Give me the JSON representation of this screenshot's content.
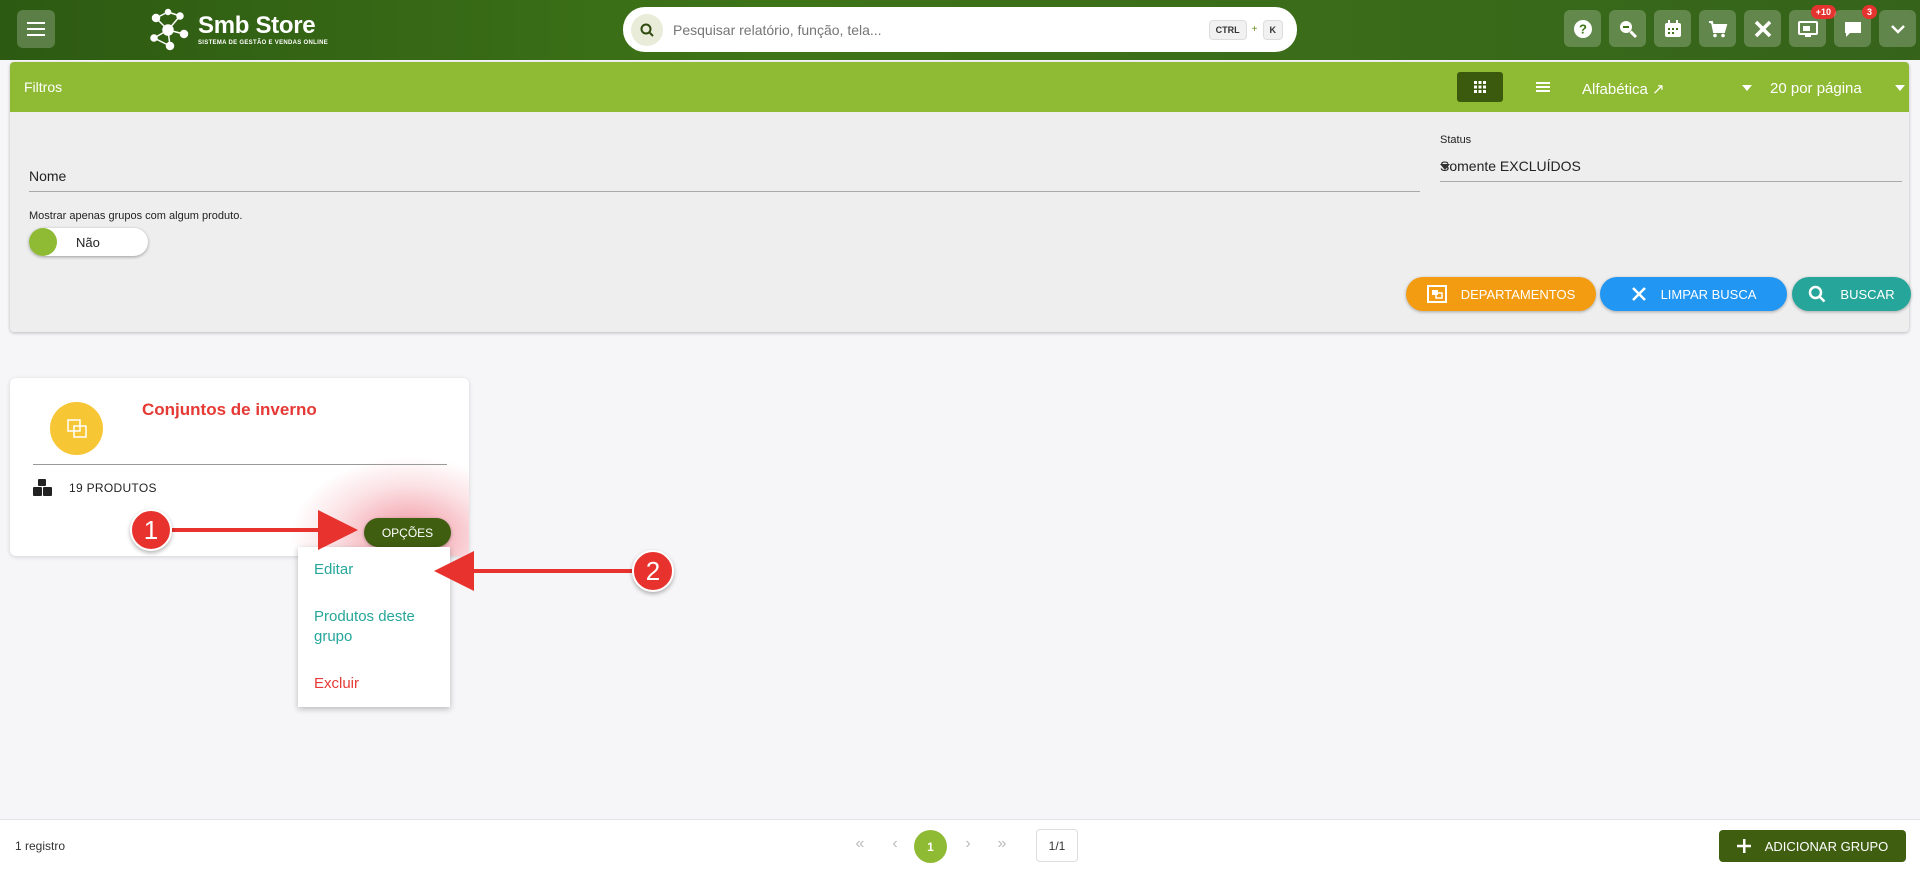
{
  "app": {
    "logo_name": "Smb Store",
    "logo_subtitle": "SISTEMA DE GESTÃO E VENDAS ONLINE"
  },
  "search": {
    "placeholder": "Pesquisar relatório, função, tela...",
    "shortcut_ctrl": "CTRL",
    "shortcut_plus": "+",
    "shortcut_key": "K"
  },
  "top_icons": [
    {
      "icon": "help-icon"
    },
    {
      "icon": "zoom-icon"
    },
    {
      "icon": "calendar-icon"
    },
    {
      "icon": "cart-icon"
    },
    {
      "icon": "tools-icon"
    },
    {
      "icon": "display-icon",
      "badge": "+10"
    },
    {
      "icon": "chat-icon",
      "badge": "3"
    },
    {
      "icon": "chevron-down-icon"
    }
  ],
  "filters": {
    "title": "Filtros",
    "sort_value": "Alfabética ↗",
    "per_page_value": "20 por página",
    "name_label": "Nome",
    "status_label": "Status",
    "status_value": "Somente EXCLUÍDOS",
    "toggle_label": "Mostrar apenas grupos com algum produto.",
    "toggle_value": "Não",
    "btn_departments": "DEPARTAMENTOS",
    "btn_clear": "LIMPAR BUSCA",
    "btn_search": "BUSCAR"
  },
  "card": {
    "title": "Conjuntos de inverno",
    "products": "19 PRODUTOS",
    "options_label": "OPÇÕES"
  },
  "dropdown": {
    "edit": "Editar",
    "products": "Produtos deste grupo",
    "delete": "Excluir"
  },
  "annotations": {
    "marker1": "1",
    "marker2": "2"
  },
  "footer": {
    "count": "1 registro",
    "current_page": "1",
    "total_pages": "1/1",
    "add_label": "ADICIONAR GRUPO"
  },
  "colors": {
    "brand_green": "#3f5e10",
    "filter_header": "#8fba33",
    "accent_orange": "#f39c12",
    "accent_blue": "#2196f3",
    "accent_teal": "#26a69a",
    "title_red": "#e53935"
  }
}
